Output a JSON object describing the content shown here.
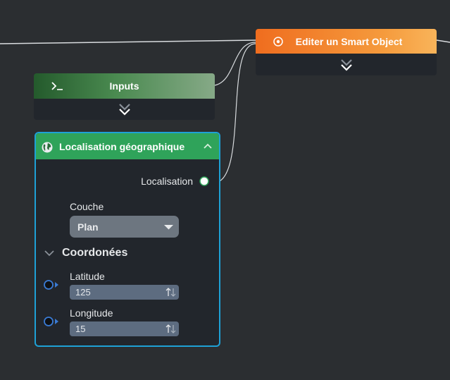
{
  "nodes": {
    "edit_smart_object": {
      "title": "Editer un Smart Object",
      "icon": "target-icon",
      "color": "#ef6d1f"
    },
    "inputs": {
      "title": "Inputs",
      "icon": "terminal-icon",
      "color": "#2f6b37"
    },
    "geo": {
      "title": "Localisation géographique",
      "icon": "globe-icon",
      "color": "#2fa35a",
      "border_color": "#1ea1d6",
      "output_label": "Localisation",
      "layer_label": "Couche",
      "layer_value": "Plan",
      "section_title": "Coordonées",
      "latitude_label": "Latitude",
      "latitude_value": "125",
      "longitude_label": "Longitude",
      "longitude_value": "15"
    }
  },
  "colors": {
    "canvas": "#2b2e31",
    "port_in": "#3a7bd5",
    "port_out": "#2fa35a"
  }
}
